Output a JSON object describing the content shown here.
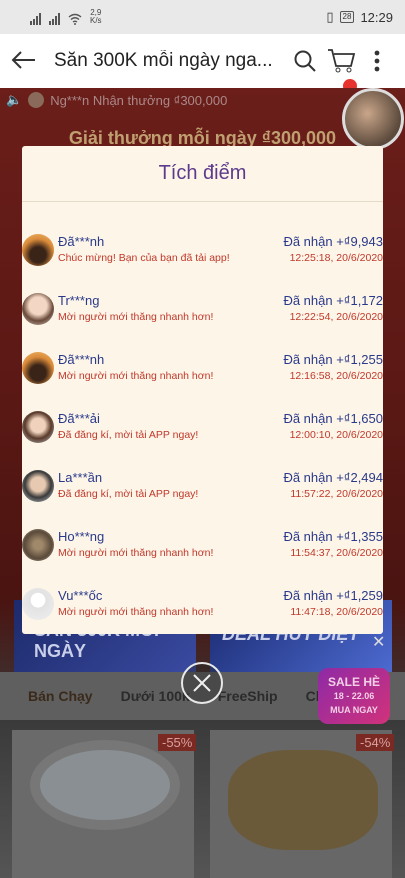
{
  "status": {
    "speed": "2,9\nK/s",
    "battery": "28",
    "time": "12:29"
  },
  "header": {
    "title": "Săn 300K mỗi ngày nga..."
  },
  "background": {
    "ticker": "Ng***n Nhận thưởng ₫300,000",
    "banner_title": "Giải thưởng mỗi ngày ₫300,000",
    "promo_left": "SĂN 300K MỖI NGÀY",
    "promo_right": "DEAL HỦY DIỆT",
    "tabs": [
      "Bán Chạy",
      "Dưới 100k",
      "FreeShip",
      "Ch"
    ],
    "sale_badge": {
      "line1": "SALE HÈ",
      "line2": "18 - 22.06",
      "line3": "MUA NGAY"
    },
    "discounts": [
      "-55%",
      "-54%"
    ]
  },
  "modal": {
    "title": "Tích điểm",
    "rows": [
      {
        "name": "Đã***nh",
        "message": "Chúc mừng! Bạn của bạn đã tải app!",
        "amount": "Đã nhận +₫9,943",
        "time": "12:25:18, 20/6/2020",
        "avatar": "sunset"
      },
      {
        "name": "Tr***ng",
        "message": "Mời người mới thăng nhanh hơn!",
        "amount": "Đã nhận +₫1,172",
        "time": "12:22:54, 20/6/2020",
        "avatar": "girl"
      },
      {
        "name": "Đã***nh",
        "message": "Mời người mới thăng nhanh hơn!",
        "amount": "Đã nhận +₫1,255",
        "time": "12:16:58, 20/6/2020",
        "avatar": "sunset"
      },
      {
        "name": "Đã***ải",
        "message": "Đã đăng kí, mời tải APP ngay!",
        "amount": "Đã nhận +₫1,650",
        "time": "12:00:10, 20/6/2020",
        "avatar": "girl2"
      },
      {
        "name": "La***ần",
        "message": "Đã đăng kí, mời tải APP ngay!",
        "amount": "Đã nhận +₫2,494",
        "time": "11:57:22, 20/6/2020",
        "avatar": "man"
      },
      {
        "name": "Ho***ng",
        "message": "Mời người mới thăng nhanh hơn!",
        "amount": "Đã nhận +₫1,355",
        "time": "11:54:37, 20/6/2020",
        "avatar": "group"
      },
      {
        "name": "Vu***ốc",
        "message": "Mời người mới thăng nhanh hơn!",
        "amount": "Đã nhận +₫1,259",
        "time": "11:47:18, 20/6/2020",
        "avatar": "default"
      }
    ]
  },
  "icons": {
    "back": "arrow-left-icon",
    "search": "search-icon",
    "cart": "cart-icon",
    "more": "more-vertical-icon",
    "close": "close-circle-icon",
    "sound": "speaker-icon"
  }
}
